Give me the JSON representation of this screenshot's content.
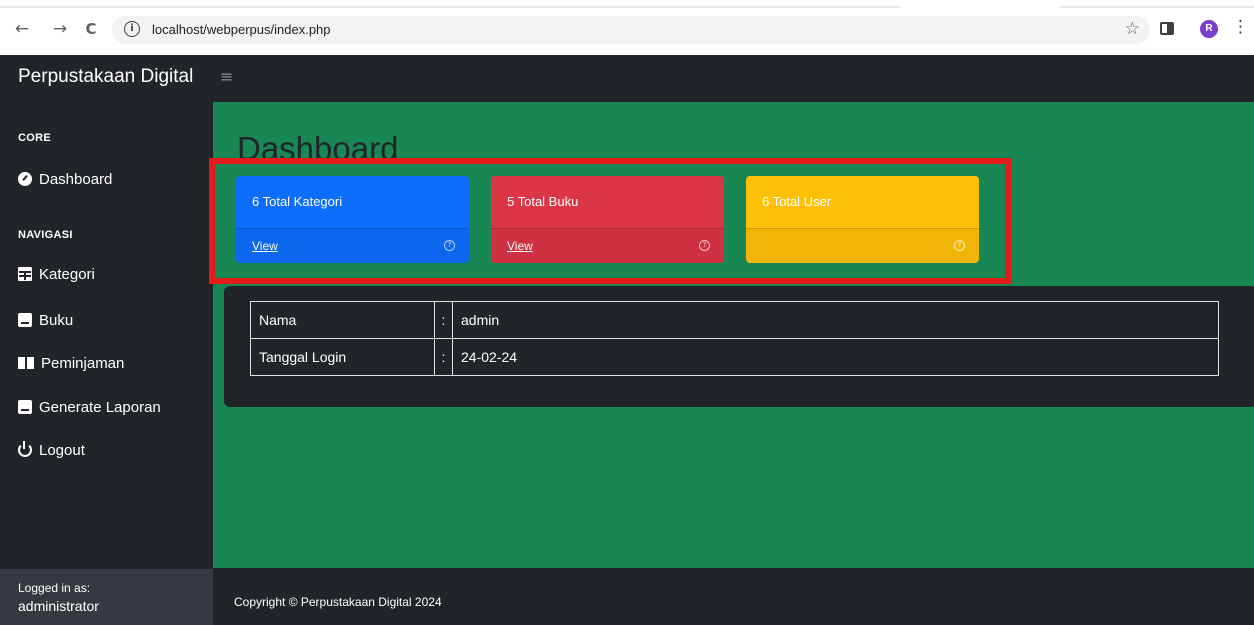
{
  "browser": {
    "url": "localhost/webperpus/index.php",
    "back": "←",
    "forward": "→",
    "reload": "C",
    "info": "i",
    "star": "☆",
    "profile_initial": "R",
    "menu": "⋮"
  },
  "app": {
    "brand": "Perpustakaan Digital",
    "toggle": "≡"
  },
  "sidebar": {
    "core_heading": "CORE",
    "nav_heading": "NAVIGASI",
    "items": [
      {
        "label": "Dashboard",
        "icon": "tachometer-icon"
      },
      {
        "label": "Kategori",
        "icon": "table-icon"
      },
      {
        "label": "Buku",
        "icon": "book-icon"
      },
      {
        "label": "Peminjaman",
        "icon": "book-open-icon"
      },
      {
        "label": "Generate Laporan",
        "icon": "book-icon"
      },
      {
        "label": "Logout",
        "icon": "power-icon"
      }
    ],
    "logged_in_label": "Logged in as:",
    "logged_in_user": "administrator"
  },
  "main": {
    "title": "Dashboard",
    "cards": [
      {
        "text": "6 Total Kategori",
        "link": "View",
        "color": "#0d6efd"
      },
      {
        "text": "5 Total Buku",
        "link": "View",
        "color": "#dc3545"
      },
      {
        "text": "6 Total User",
        "link": "",
        "color": "#ffc107"
      }
    ],
    "info": [
      {
        "label": "Nama",
        "sep": ":",
        "value": "admin"
      },
      {
        "label": "Tanggal Login",
        "sep": ":",
        "value": "24-02-24"
      }
    ]
  },
  "footer": {
    "copyright": "Copyright © Perpustakaan Digital 2024"
  },
  "colors": {
    "main_bg": "#198754",
    "dark": "#212529",
    "highlight": "#e31b1b"
  }
}
